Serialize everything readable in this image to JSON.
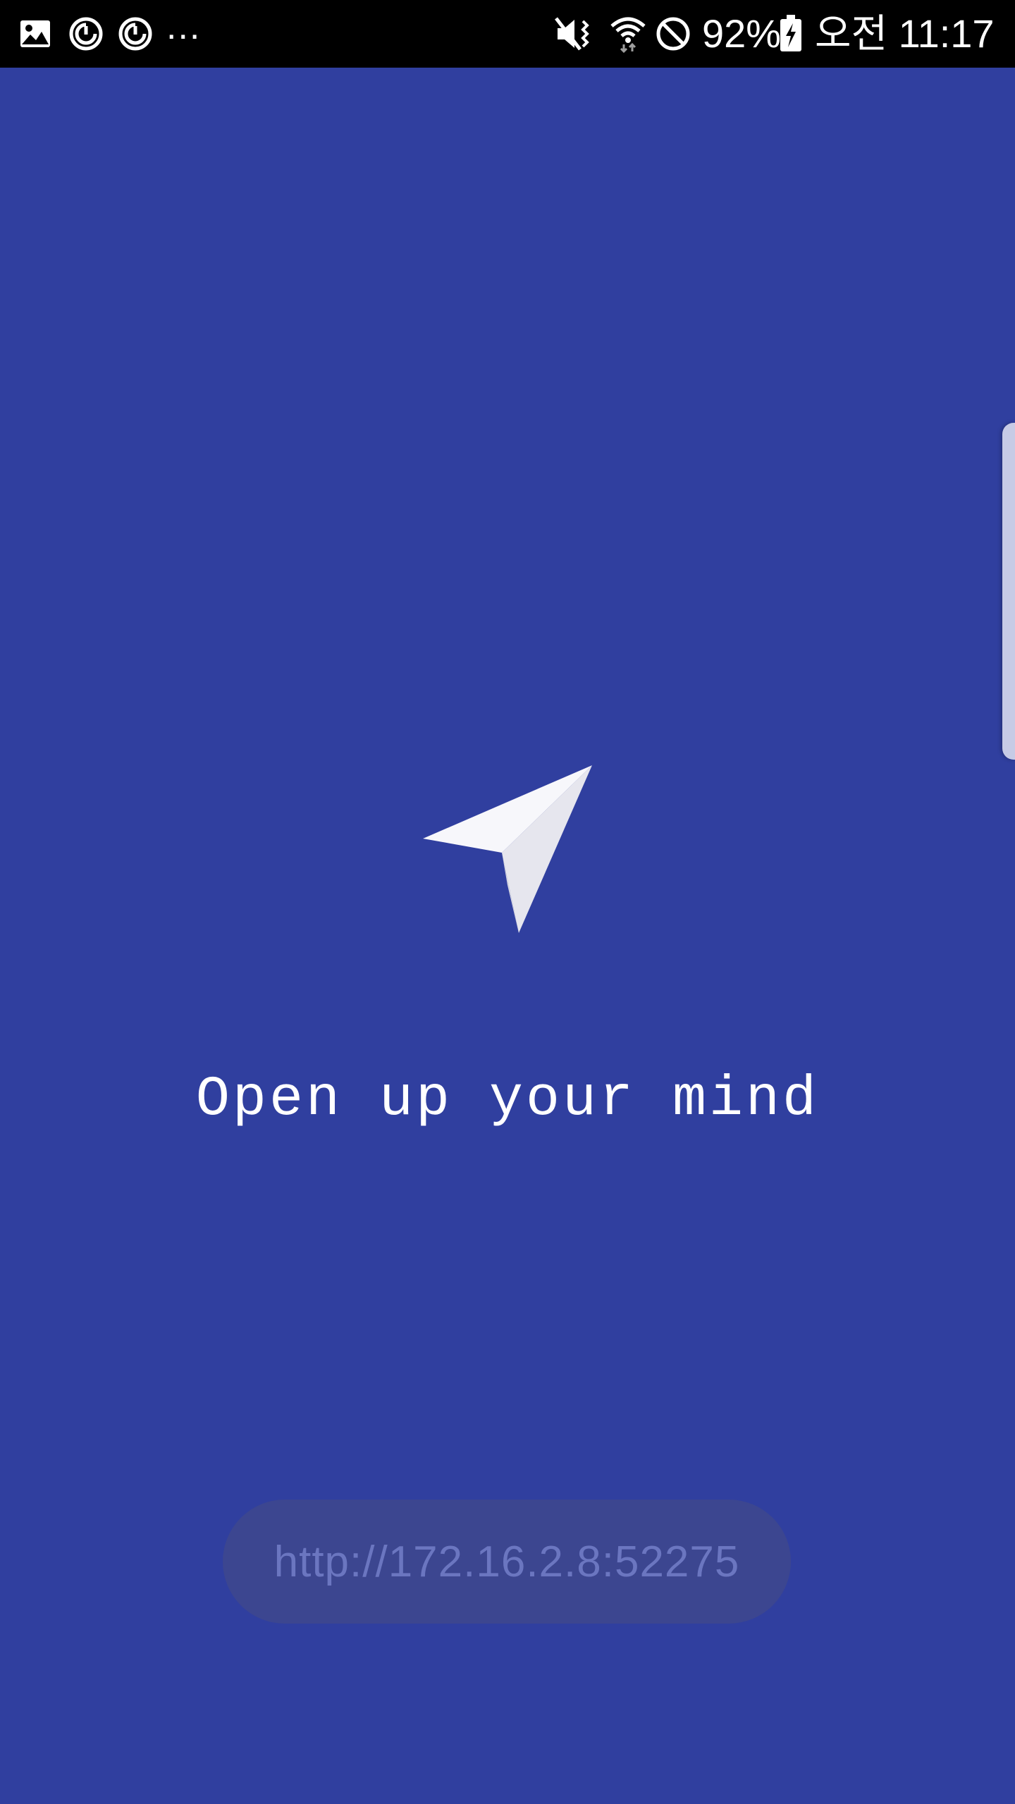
{
  "status_bar": {
    "icons_left": [
      "gallery-icon",
      "sync-icon",
      "sync-icon",
      "more-notifications-icon"
    ],
    "overflow": "...",
    "icons_right": [
      "mute-icon",
      "wifi-icon",
      "blocked-icon",
      "battery-charging-icon"
    ],
    "battery_percent": "92%",
    "time": "오전 11:17"
  },
  "main": {
    "logo": "paper-plane-icon",
    "tagline": "Open up your mind",
    "server_url": "http://172.16.2.8:52275"
  },
  "colors": {
    "background": "#303f9f",
    "status_bar": "#000000",
    "text": "#ffffff",
    "pill_background": "#3c4690",
    "pill_text": "#6b76c0"
  }
}
